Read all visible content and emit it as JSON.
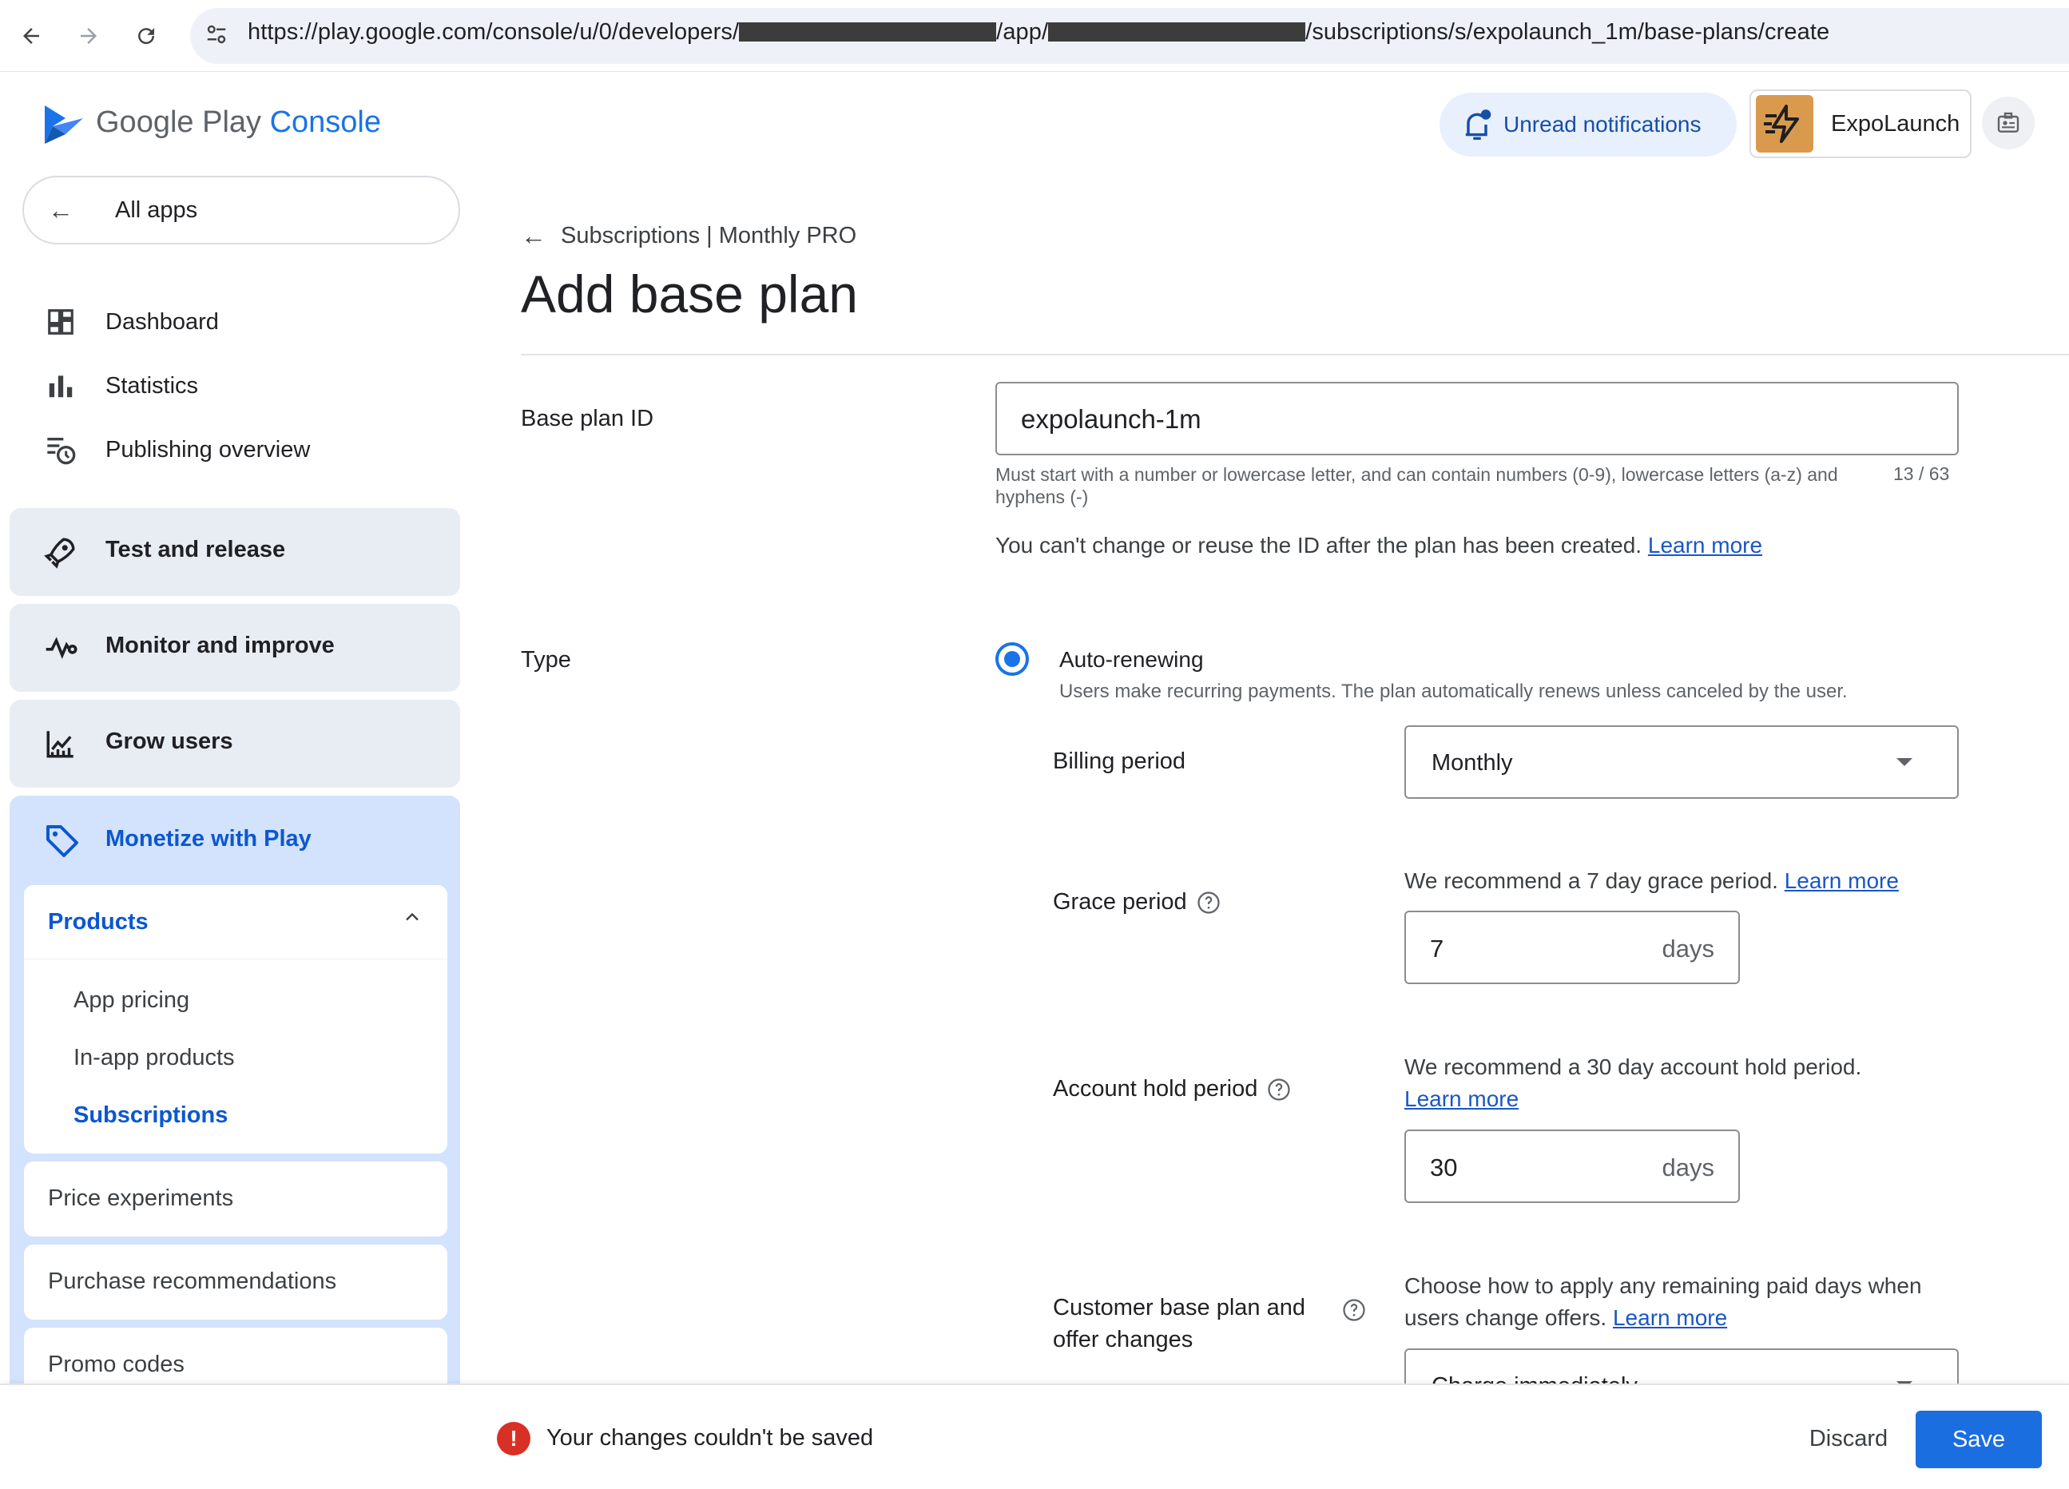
{
  "browser": {
    "url_prefix": "https://play.google.com/console/u/0/developers/",
    "url_mid": "/app/",
    "url_suffix": "/subscriptions/s/expolaunch_1m/base-plans/create"
  },
  "header": {
    "logo_google_play": "Google Play",
    "logo_console": "Console",
    "notifications_label": "Unread notifications",
    "account_name": "ExpoLaunch"
  },
  "sidebar": {
    "all_apps": "All apps",
    "items": [
      {
        "label": "Dashboard",
        "icon": "dashboard-icon"
      },
      {
        "label": "Statistics",
        "icon": "bar-chart-icon"
      },
      {
        "label": "Publishing overview",
        "icon": "publishing-history-icon"
      }
    ],
    "groups": [
      {
        "label": "Test and release",
        "icon": "rocket-icon"
      },
      {
        "label": "Monitor and improve",
        "icon": "vitals-icon"
      },
      {
        "label": "Grow users",
        "icon": "growth-chart-icon"
      }
    ],
    "monetize": {
      "label": "Monetize with Play",
      "icon": "tag-icon",
      "products": {
        "label": "Products",
        "items": [
          "App pricing",
          "In-app products",
          "Subscriptions"
        ],
        "active": "Subscriptions"
      },
      "cards": [
        "Price experiments",
        "Purchase recommendations",
        "Promo codes"
      ]
    }
  },
  "main": {
    "breadcrumb": "Subscriptions | Monthly PRO",
    "title": "Add base plan",
    "base_plan_id": {
      "label": "Base plan ID",
      "value": "expolaunch-1m",
      "hint": "Must start with a number or lowercase letter, and can contain numbers (0-9), lowercase letters (a-z) and hyphens (-)",
      "counter": "13 / 63",
      "note": "You can't change or reuse the ID after the plan has been created.",
      "learn_more": "Learn more"
    },
    "type": {
      "label": "Type",
      "option_label": "Auto-renewing",
      "option_desc": "Users make recurring payments. The plan automatically renews unless canceled by the user.",
      "selected": true
    },
    "billing_period": {
      "label": "Billing period",
      "value": "Monthly"
    },
    "grace_period": {
      "label": "Grace period",
      "recommendation": "We recommend a 7 day grace period.",
      "learn_more": "Learn more",
      "value": "7",
      "unit": "days"
    },
    "account_hold": {
      "label": "Account hold period",
      "recommendation": "We recommend a 30 day account hold period.",
      "learn_more": "Learn more",
      "value": "30",
      "unit": "days"
    },
    "offer_changes": {
      "label_line1": "Customer base plan and",
      "label_line2": "offer changes",
      "recommendation_line1": "Choose how to apply any remaining paid days when",
      "recommendation_line2": "users change offers.",
      "learn_more": "Learn more",
      "value": "Charge immediately"
    }
  },
  "bottom_bar": {
    "error": "Your changes couldn't be saved",
    "discard": "Discard",
    "save": "Save"
  },
  "colors": {
    "primary": "#1a73e8",
    "active_nav_bg": "#d3e3fd",
    "group_bg": "#e8ecf3",
    "error": "#d93025",
    "save_button": "#1a6ee0"
  }
}
